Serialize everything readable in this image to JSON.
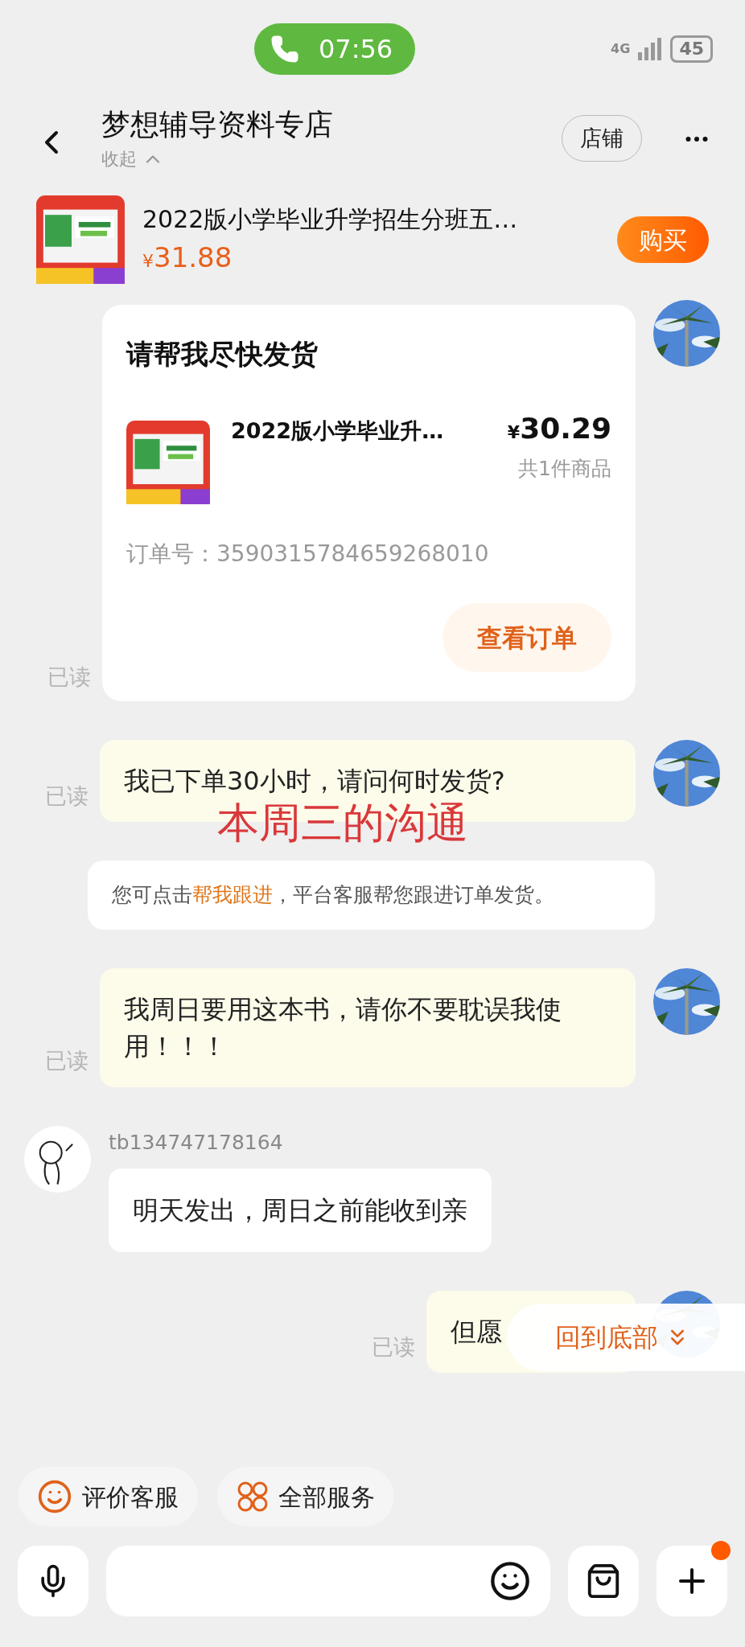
{
  "status_bar": {
    "call_time": "07:56",
    "network": "4G",
    "battery": "45"
  },
  "header": {
    "title": "梦想辅导资料专店",
    "collapse": "收起",
    "shop_button": "店铺"
  },
  "product": {
    "title": "2022版小学毕业升学招生分班五…",
    "currency": "¥",
    "price": "31.88",
    "buy_button": "购买"
  },
  "messages": [
    {
      "kind": "order",
      "title": "请帮我尽快发货",
      "item_title": "2022版小学毕业升…",
      "currency": "¥",
      "price": "30.29",
      "count": "共1件商品",
      "order_label": "订单号：",
      "order_no": "3590315784659268010",
      "button": "查看订单",
      "receipt": "已读"
    },
    {
      "kind": "outgoing",
      "text": "我已下单30小时，请问何时发货?",
      "receipt": "已读",
      "annotation": "本周三的沟通"
    },
    {
      "kind": "notice",
      "prefix": "您可点击",
      "link": "帮我跟进",
      "suffix": "，平台客服帮您跟进订单发货。"
    },
    {
      "kind": "outgoing",
      "text": "我周日要用这本书，请你不要耽误我使用！！！",
      "receipt": "已读"
    },
    {
      "kind": "incoming",
      "sender": "tb134747178164",
      "text": "明天发出，周日之前能收到亲"
    },
    {
      "kind": "outgoing",
      "text": "但愿",
      "receipt": "已读",
      "overlay_button": "回到底部"
    }
  ],
  "quick_actions": [
    {
      "kind": "rate",
      "label": "评价客服"
    },
    {
      "kind": "services",
      "label": "全部服务"
    }
  ],
  "composer": {
    "plus_badge": true
  }
}
